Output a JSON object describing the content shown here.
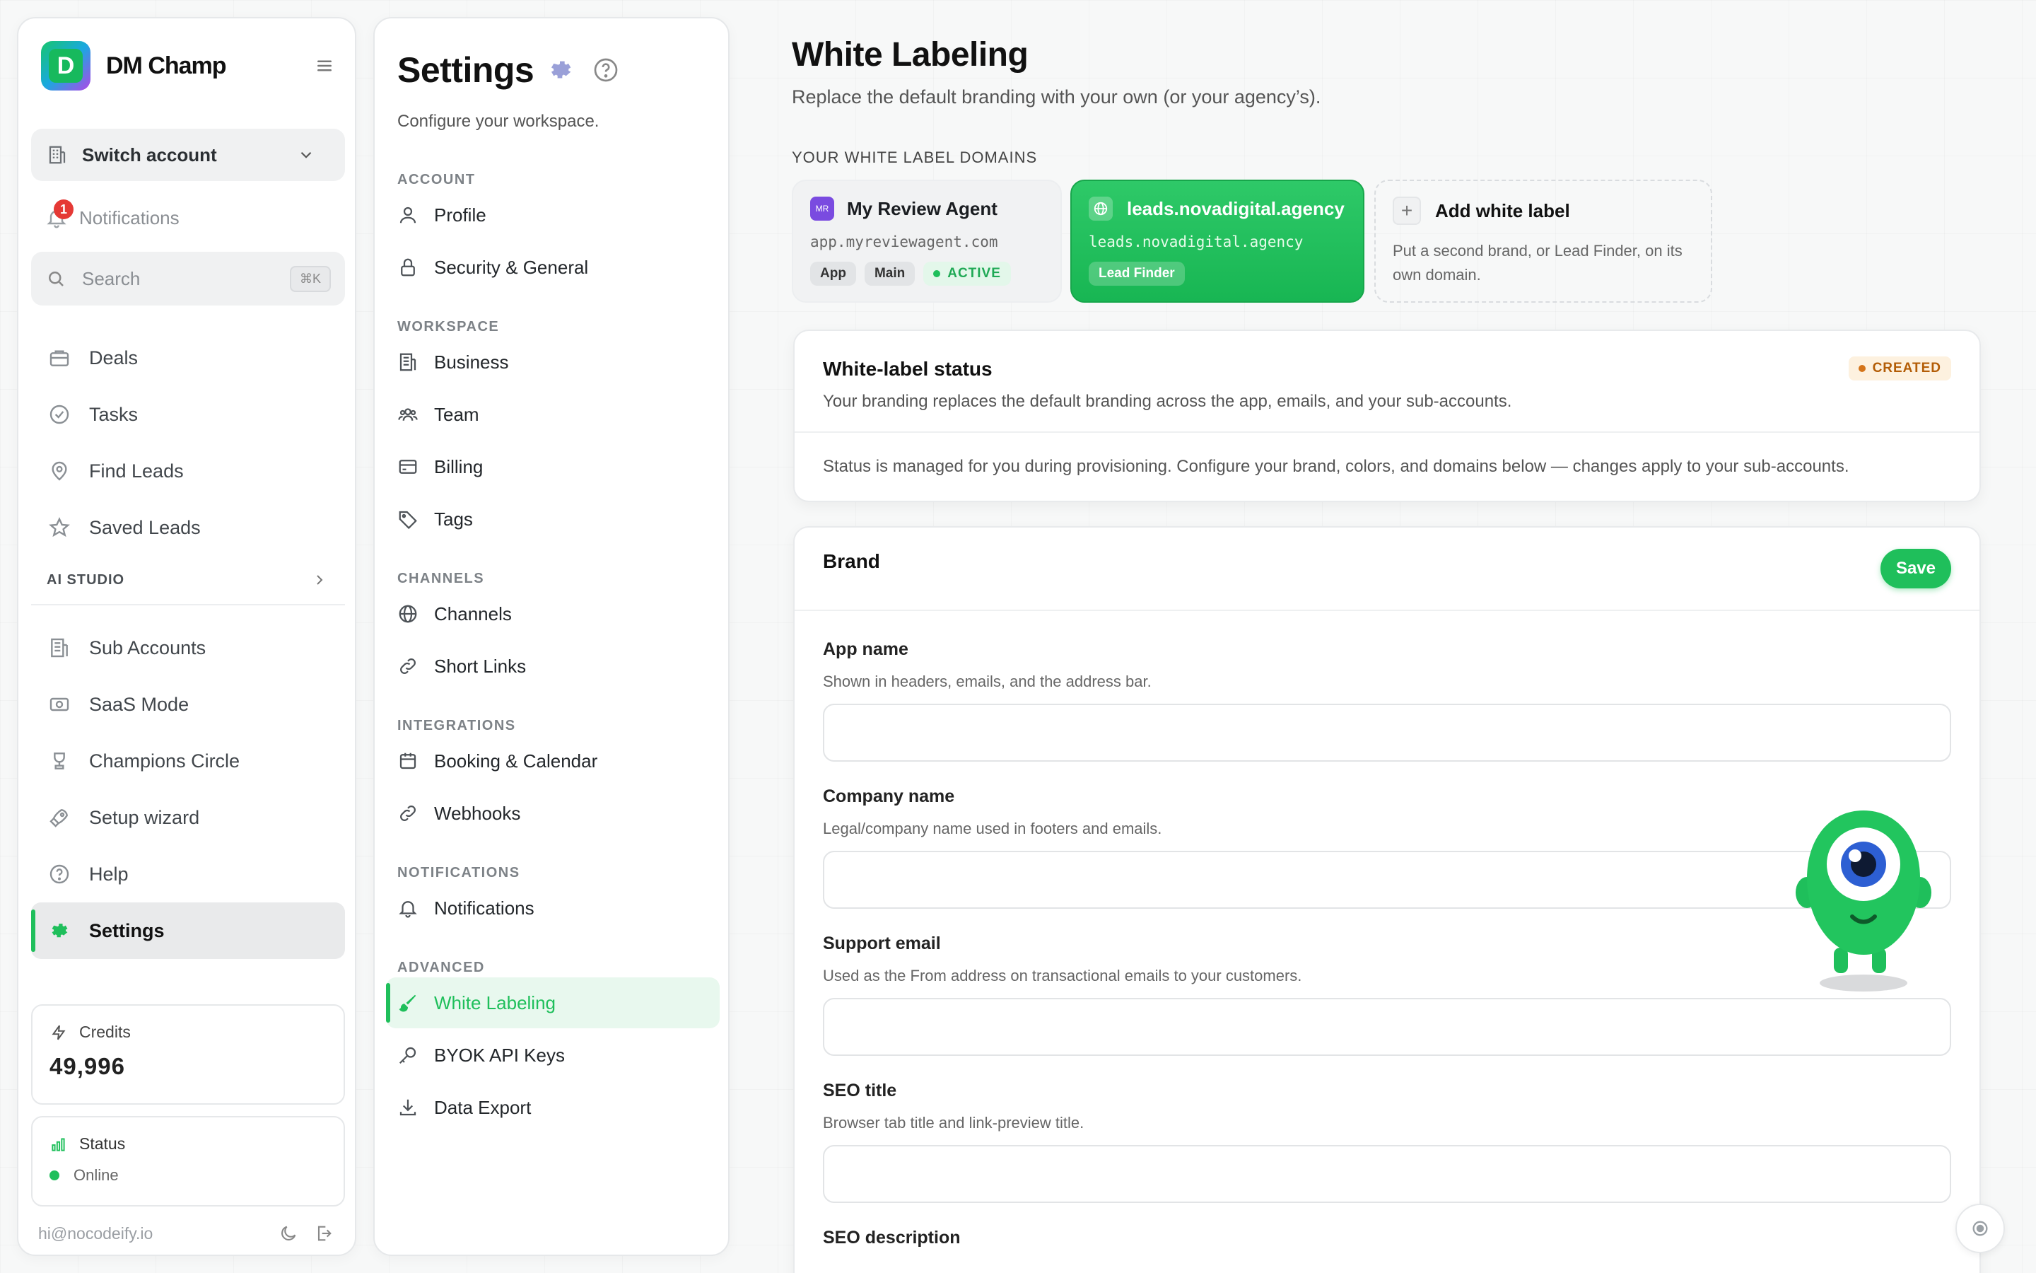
{
  "sidebar": {
    "brand": "DM Champ",
    "switch_account": "Switch account",
    "notifications": {
      "label": "Notifications",
      "badge": "1"
    },
    "search": {
      "placeholder": "Search",
      "shortcut": "⌘K"
    },
    "nav_top": [
      {
        "label": "Deals",
        "icon": "briefcase-icon"
      },
      {
        "label": "Tasks",
        "icon": "check-circle-icon"
      },
      {
        "label": "Find Leads",
        "icon": "map-pin-icon"
      },
      {
        "label": "Saved Leads",
        "icon": "star-icon"
      }
    ],
    "ai_studio": "AI STUDIO",
    "nav_bottom": [
      {
        "label": "Sub Accounts",
        "icon": "building-icon"
      },
      {
        "label": "SaaS Mode",
        "icon": "money-icon"
      },
      {
        "label": "Champions Circle",
        "icon": "trophy-icon"
      },
      {
        "label": "Setup wizard",
        "icon": "rocket-icon"
      },
      {
        "label": "Help",
        "icon": "help-icon"
      },
      {
        "label": "Settings",
        "icon": "gear-icon",
        "active": true
      }
    ],
    "credits": {
      "label": "Credits",
      "value": "49,996"
    },
    "status": {
      "label": "Status",
      "value": "Online"
    },
    "email": "hi@nocodeify.io"
  },
  "settings": {
    "title": "Settings",
    "subtitle": "Configure your workspace.",
    "sections": [
      {
        "label": "ACCOUNT",
        "items": [
          "Profile",
          "Security & General"
        ]
      },
      {
        "label": "WORKSPACE",
        "items": [
          "Business",
          "Team",
          "Billing",
          "Tags"
        ]
      },
      {
        "label": "CHANNELS",
        "items": [
          "Channels",
          "Short Links"
        ]
      },
      {
        "label": "INTEGRATIONS",
        "items": [
          "Booking & Calendar",
          "Webhooks"
        ]
      },
      {
        "label": "NOTIFICATIONS",
        "items": [
          "Notifications"
        ]
      },
      {
        "label": "ADVANCED",
        "items": [
          "White Labeling",
          "BYOK API Keys",
          "Data Export"
        ]
      }
    ],
    "active_item": "White Labeling"
  },
  "main": {
    "title": "White Labeling",
    "subtitle": "Replace the default branding with your own (or your agency’s).",
    "domains_label": "YOUR WHITE LABEL DOMAINS",
    "domains": [
      {
        "badge": "MR",
        "name": "My Review Agent",
        "url": "app.myreviewagent.com",
        "chips": [
          "App",
          "Main"
        ],
        "status": "ACTIVE"
      },
      {
        "name": "leads.novadigital.agency",
        "url": "leads.novadigital.agency",
        "chips": [
          "Lead Finder"
        ]
      }
    ],
    "add_card": {
      "title": "Add white label",
      "desc": "Put a second brand, or Lead Finder, on its own domain."
    },
    "status_panel": {
      "title": "White-label status",
      "subtitle": "Your branding replaces the default branding across the app, emails, and your sub-accounts.",
      "badge": "CREATED",
      "note": "Status is managed for you during provisioning. Configure your brand, colors, and domains below — changes apply to your sub-accounts."
    },
    "brand_panel": {
      "title": "Brand",
      "save": "Save",
      "fields": [
        {
          "label": "App name",
          "help": "Shown in headers, emails, and the address bar.",
          "value": ""
        },
        {
          "label": "Company name",
          "help": "Legal/company name used in footers and emails.",
          "value": ""
        },
        {
          "label": "Support email",
          "help": "Used as the From address on transactional emails to your customers.",
          "value": ""
        },
        {
          "label": "SEO title",
          "help": "Browser tab title and link-preview title.",
          "value": ""
        },
        {
          "label": "SEO description",
          "help": "",
          "value": ""
        }
      ]
    }
  },
  "colors": {
    "accent": "#1fbf5b",
    "warning": "#b35d07",
    "danger": "#e53935"
  }
}
